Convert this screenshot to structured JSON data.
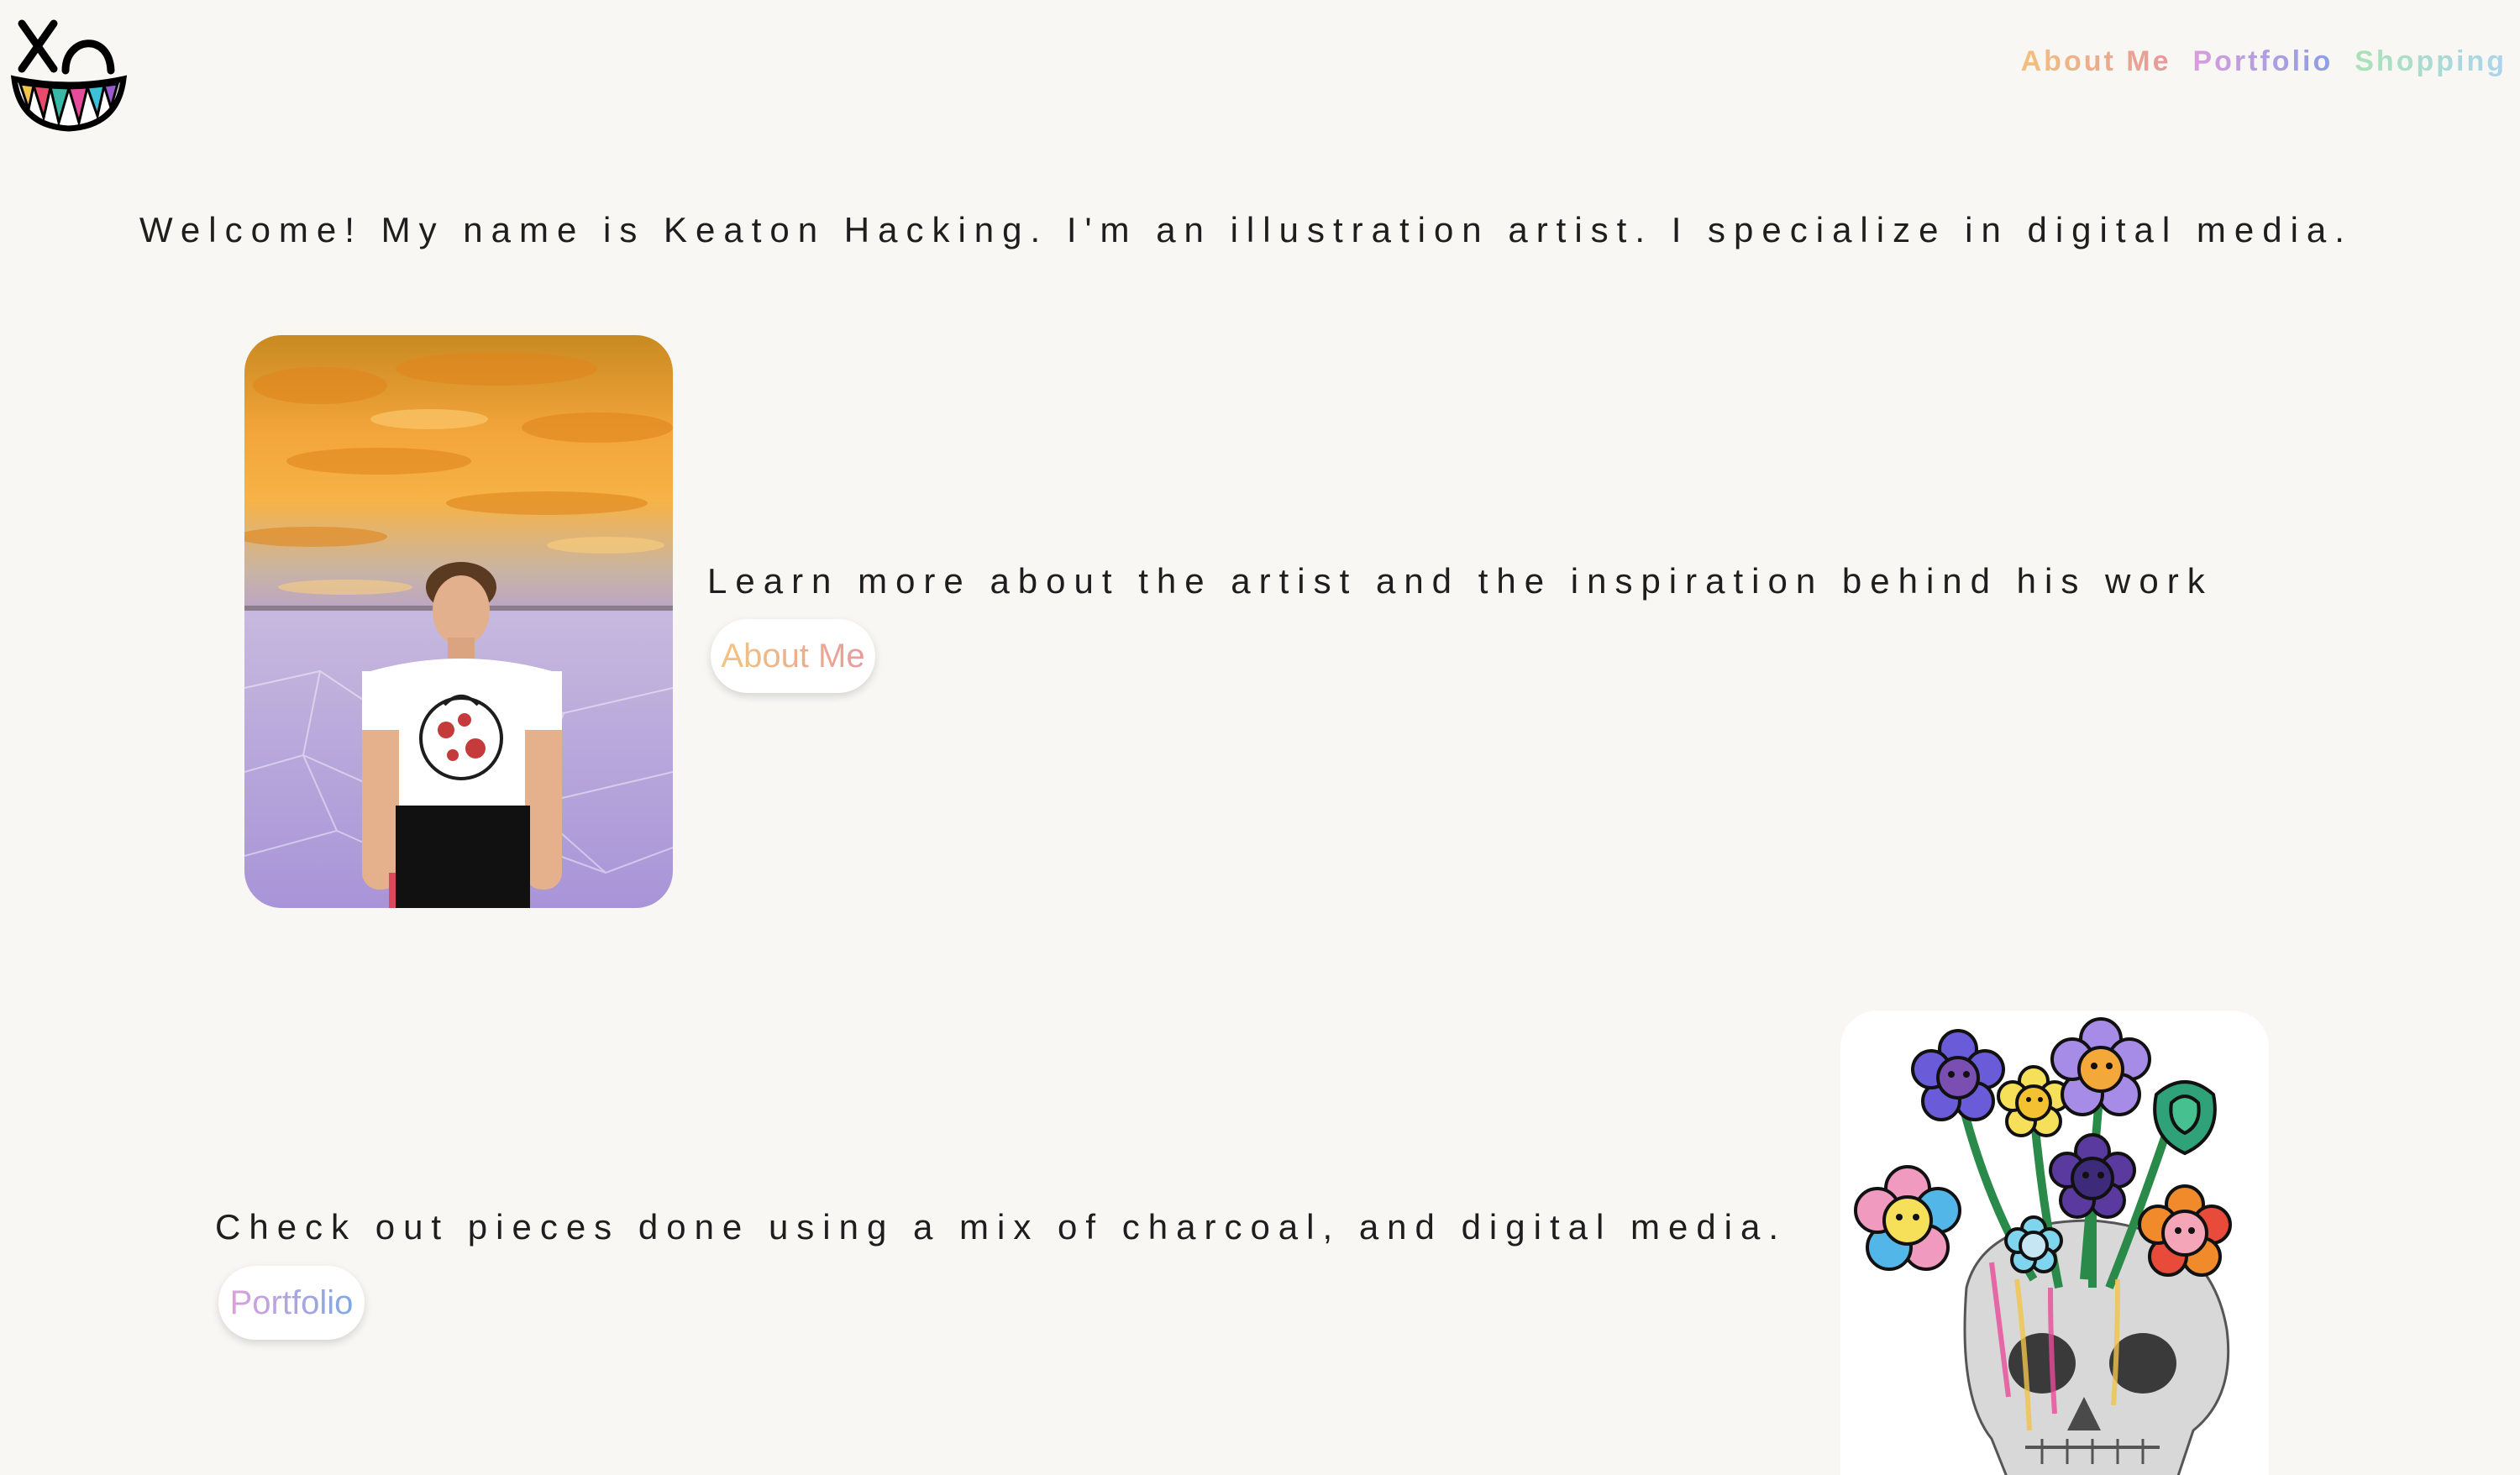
{
  "logo": {
    "alt_mark": "XD"
  },
  "nav": {
    "items": [
      {
        "label": "About Me"
      },
      {
        "label": "Portfolio"
      },
      {
        "label": "Shopping"
      }
    ]
  },
  "hero": {
    "welcome_text": "Welcome! My name is Keaton Hacking. I'm an illustration artist. I specialize in digital media."
  },
  "about_section": {
    "text": "Learn more about the artist and the inspiration behind his work",
    "button_label": "About Me"
  },
  "portfolio_section": {
    "text": "Check out pieces done using a mix of charcoal, and digital media.",
    "button_label": "Portfolio"
  },
  "colors": {
    "background": "#f9f7f4",
    "about_gradient": [
      "#f2c17c",
      "#e6999b"
    ],
    "portfolio_gradient": [
      "#d99ddd",
      "#8c9ee6"
    ],
    "shopping_gradient": [
      "#a9e2b7",
      "#aad4ee"
    ]
  }
}
